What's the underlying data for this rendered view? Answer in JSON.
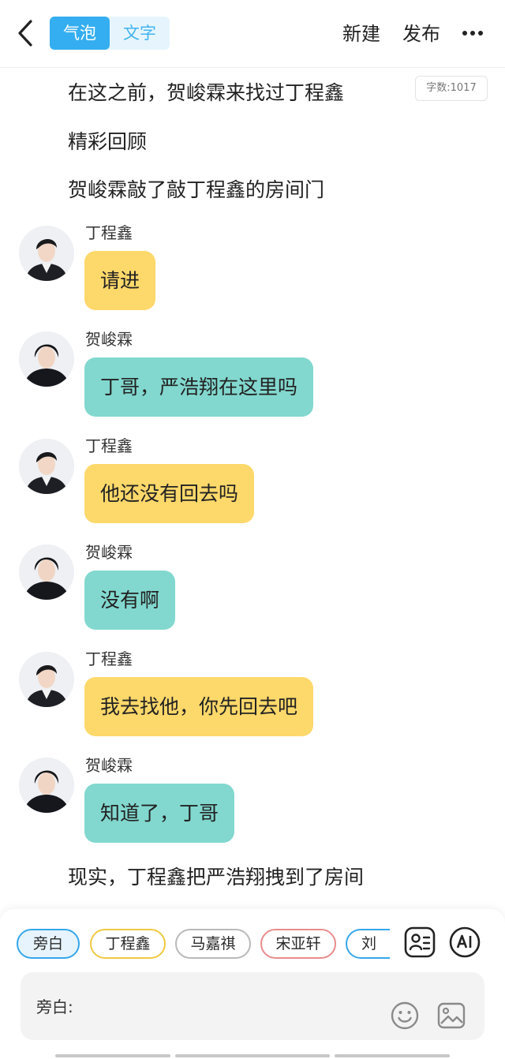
{
  "header": {
    "tabs": [
      {
        "label": "气泡",
        "active": true
      },
      {
        "label": "文字",
        "active": false
      }
    ],
    "new_label": "新建",
    "publish_label": "发布",
    "icons": {
      "back": "chevron-left-icon",
      "more": "more-dots-icon"
    }
  },
  "word_count": {
    "label": "字数:",
    "value": "1017"
  },
  "narration": [
    "在这之前，贺峻霖来找过丁程鑫",
    "精彩回顾",
    "贺峻霖敲了敲丁程鑫的房间门"
  ],
  "messages": [
    {
      "speaker": "丁程鑫",
      "text": "请进",
      "color": "#fdd86b"
    },
    {
      "speaker": "贺峻霖",
      "text": "丁哥，严浩翔在这里吗",
      "color": "#82d8cf"
    },
    {
      "speaker": "丁程鑫",
      "text": "他还没有回去吗",
      "color": "#fdd86b"
    },
    {
      "speaker": "贺峻霖",
      "text": "没有啊",
      "color": "#82d8cf"
    },
    {
      "speaker": "丁程鑫",
      "text": "我去找他，你先回去吧",
      "color": "#fdd86b"
    },
    {
      "speaker": "贺峻霖",
      "text": "知道了，丁哥",
      "color": "#82d8cf"
    }
  ],
  "narration_after": "现实，丁程鑫把严浩翔拽到了房间",
  "roles": [
    "旁白",
    "丁程鑫",
    "马嘉祺",
    "宋亚轩",
    "刘耀"
  ],
  "input": {
    "label": "旁白:"
  },
  "colors": {
    "accent": "#34aef0",
    "yellow_bubble": "#fdd86b",
    "teal_bubble": "#82d8cf"
  }
}
